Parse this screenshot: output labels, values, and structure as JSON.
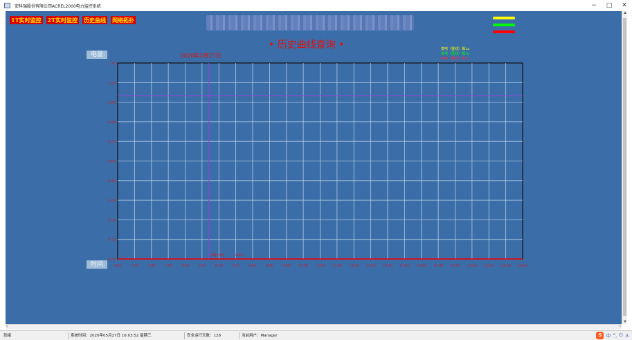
{
  "window": {
    "title": "安科瑞股份有限公司ACREL2000电力监控系统",
    "controls": [
      "−",
      "□",
      "✕"
    ]
  },
  "nav": {
    "buttons": [
      "1T实时监控",
      "2T实时监控",
      "历史曲线",
      "网络拓扑"
    ]
  },
  "page": {
    "title": "• 历史曲线查询 •"
  },
  "legend": {
    "swatch_colors": [
      "#ffff00",
      "#00ff00",
      "#ff0000"
    ],
    "series_labels": [
      {
        "text": "变电（重线）相1a",
        "color": "#ffff00"
      },
      {
        "text": "变电（重线）相1b",
        "color": "#00ff00"
      },
      {
        "text": "变电（重线）相1c",
        "color": "#ff0000"
      }
    ]
  },
  "chart_data": {
    "type": "line",
    "date_label": "2020年5月27日",
    "ylabel": "电量",
    "xlabel": "时间",
    "ylim": [
      0,
      1.2
    ],
    "y_ticks": [
      "1.20",
      "1.08",
      "0.96",
      "0.84",
      "0.72",
      "0.60",
      "0.48",
      "0.36",
      "0.24",
      "0.12",
      "0.00"
    ],
    "x_ticks": [
      "0:00",
      "1:00",
      "2:00",
      "3:00",
      "4:00",
      "5:00",
      "6:00",
      "7:00",
      "8:00",
      "9:00",
      "10:00",
      "11:00",
      "12:00",
      "13:00",
      "14:00",
      "15:00",
      "16:00",
      "17:00",
      "18:00",
      "19:00",
      "20:00",
      "21:00",
      "22:00",
      "23:00",
      "24:00"
    ],
    "grid": true,
    "reference_line_y": 1.0,
    "cursor": {
      "x_hour": 5.4,
      "label": "5时19分",
      "value": "0.00"
    },
    "series": [
      {
        "color": "#ff0000",
        "x": [
          0,
          24
        ],
        "values": [
          0,
          0
        ]
      }
    ]
  },
  "status": {
    "state": "就绪",
    "system_time": "系统时间：2020年05月27日 16:03:52 星期三",
    "run_days": "安全运行天数：128",
    "current_user": "当前用户：Manager"
  }
}
